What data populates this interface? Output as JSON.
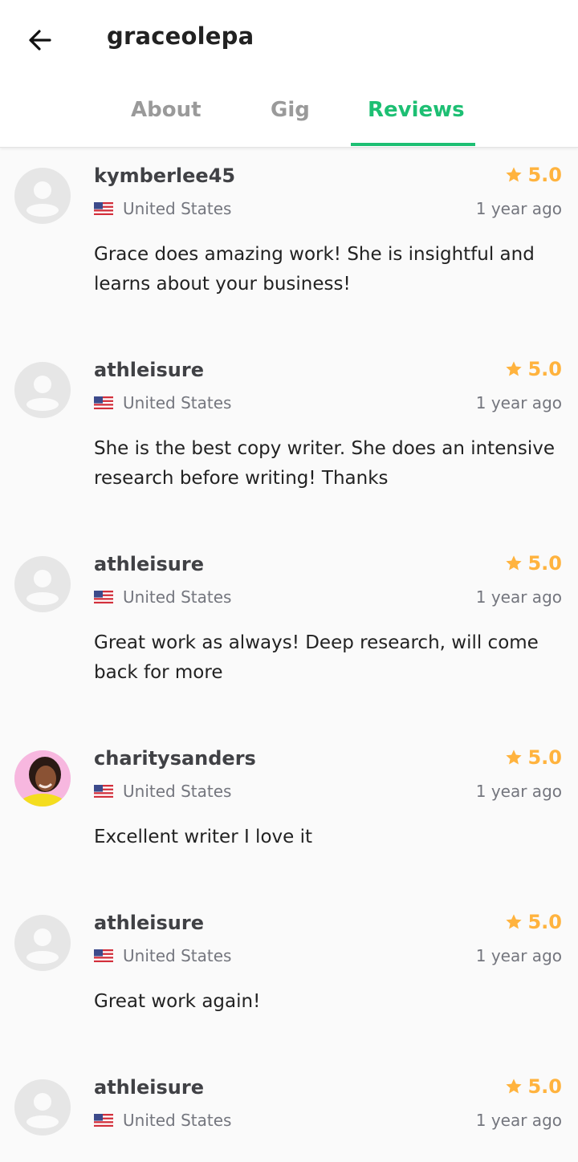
{
  "header": {
    "title": "graceolepa"
  },
  "tabs": [
    {
      "label": "About"
    },
    {
      "label": "Gig"
    },
    {
      "label": "Reviews"
    }
  ],
  "active_tab": "Reviews",
  "colors": {
    "accent": "#1dbf73",
    "star": "#ffb33e"
  },
  "reviews": [
    {
      "username": "kymberlee45",
      "rating": "5.0",
      "country": "United States",
      "time": "1 year ago",
      "text": "Grace does amazing work! She is insightful and learns about your business!",
      "avatar": "default-avatar-icon"
    },
    {
      "username": "athleisure",
      "rating": "5.0",
      "country": "United States",
      "time": "1 year ago",
      "text": "She is the best copy writer. She does an intensive research before writing! Thanks",
      "avatar": "default-avatar-icon"
    },
    {
      "username": "athleisure",
      "rating": "5.0",
      "country": "United States",
      "time": "1 year ago",
      "text": "Great work as always! Deep research, will come back for more",
      "avatar": "default-avatar-icon"
    },
    {
      "username": "charitysanders",
      "rating": "5.0",
      "country": "United States",
      "time": "1 year ago",
      "text": "Excellent writer I love it",
      "avatar": "user-photo-avatar"
    },
    {
      "username": "athleisure",
      "rating": "5.0",
      "country": "United States",
      "time": "1 year ago",
      "text": "Great work again!",
      "avatar": "default-avatar-icon"
    },
    {
      "username": "athleisure",
      "rating": "5.0",
      "country": "United States",
      "time": "1 year ago",
      "text": "",
      "avatar": "default-avatar-icon"
    }
  ]
}
